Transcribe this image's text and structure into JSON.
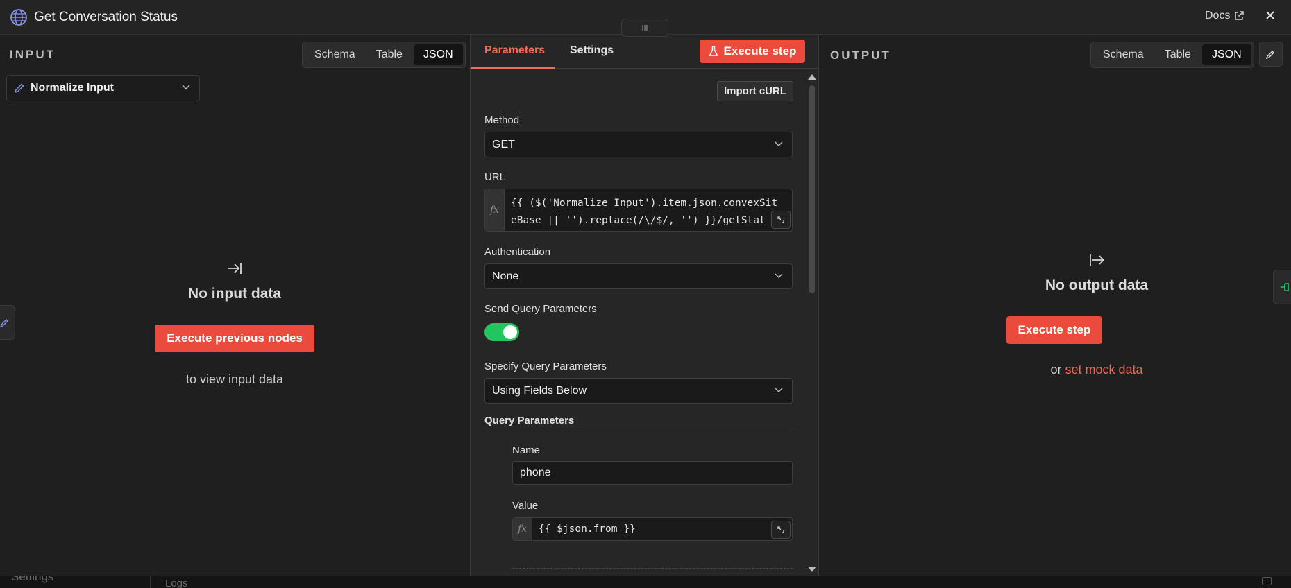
{
  "header": {
    "title": "Get Conversation Status",
    "docs_label": "Docs"
  },
  "input": {
    "panel_label": "INPUT",
    "view_options": [
      "Schema",
      "Table",
      "JSON"
    ],
    "active_view": "JSON",
    "node_select_value": "Normalize Input",
    "empty_title": "No input data",
    "execute_button": "Execute previous nodes",
    "hint": "to view input data"
  },
  "params": {
    "tabs": [
      "Parameters",
      "Settings"
    ],
    "active_tab": "Parameters",
    "execute_button": "Execute step",
    "import_curl": "Import cURL",
    "method_label": "Method",
    "method_value": "GET",
    "url_label": "URL",
    "url_line1": "{{ ($('Normalize Input').item.json.convexSit",
    "url_line2": "eBase || '').replace(/\\/$/, '') }}/getStat",
    "auth_label": "Authentication",
    "auth_value": "None",
    "send_query_label": "Send Query Parameters",
    "send_query_enabled": true,
    "specify_label": "Specify Query Parameters",
    "specify_value": "Using Fields Below",
    "query_params_label": "Query Parameters",
    "query_param": {
      "name_label": "Name",
      "name_value": "phone",
      "value_label": "Value",
      "value_expr": "{{ $json.from }}"
    }
  },
  "output": {
    "panel_label": "OUTPUT",
    "view_options": [
      "Schema",
      "Table",
      "JSON"
    ],
    "active_view": "JSON",
    "empty_title": "No output data",
    "execute_button": "Execute step",
    "mock_prefix": "or",
    "mock_link": "set mock data"
  },
  "background": {
    "settings_label": "Settings",
    "logs_label": "Logs"
  },
  "colors": {
    "accent": "#ea4b3c",
    "toggle_on": "#22c55e",
    "link": "#f26b54"
  }
}
